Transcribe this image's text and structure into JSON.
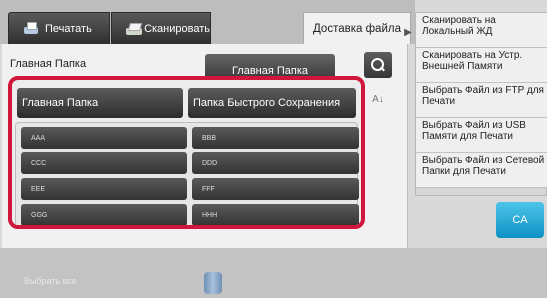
{
  "tabs": {
    "print": "Печатать",
    "scan": "Сканировать",
    "delivery": "Доставка файла"
  },
  "folder": {
    "label": "Главная Папка",
    "path": "Главная Папка"
  },
  "list": {
    "header_left": "Главная Папка",
    "header_right": "Папка Быстрого Сохранения",
    "items": [
      "AAA",
      "BBB",
      "CCC",
      "DDD",
      "EEE",
      "FFF",
      "GGG",
      "HHH"
    ]
  },
  "sort_label": "A↓",
  "right_menu": [
    "Сканировать на Локальный ЖД",
    "Сканировать на Устр. Внешней Памяти",
    "Выбрать Файл из FTP для Печати",
    "Выбрать Файл из USB Памяти для Печати",
    "Выбрать Файл из Сетевой Папки для Печати"
  ],
  "ca_label": "CA",
  "select_all": "Выбрать все",
  "icons": {
    "print": "printer-icon",
    "scan": "scanner-icon",
    "search": "search-icon",
    "storage": "storage-icon"
  },
  "colors": {
    "highlight": "#d0163a",
    "ca": "#1aa3d6"
  }
}
